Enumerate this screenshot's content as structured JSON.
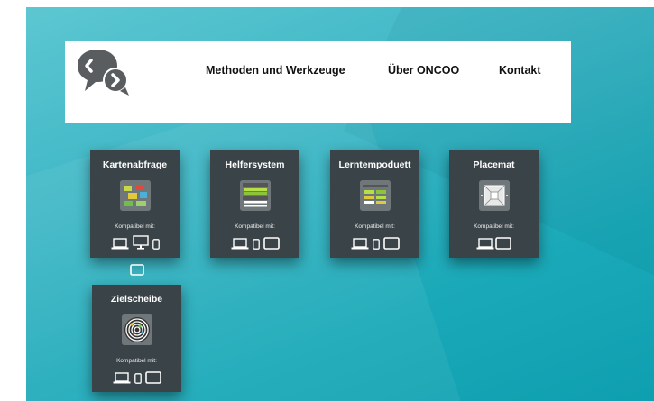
{
  "header": {
    "logo_icon": "speech-bubbles-logo-icon",
    "nav": [
      {
        "label": "Methoden und Werkzeuge"
      },
      {
        "label": "Über ONCOO"
      },
      {
        "label": "Kontakt"
      }
    ]
  },
  "cards": [
    {
      "title": "Kartenabfrage",
      "compat_label": "Kompatibel mit:",
      "image_icon": "kartenabfrage-icon",
      "devices": [
        "laptop",
        "desktop",
        "phone"
      ]
    },
    {
      "title": "Helfersystem",
      "compat_label": "Kompatibel mit:",
      "image_icon": "helfersystem-icon",
      "devices": [
        "laptop",
        "phone",
        "tablet"
      ]
    },
    {
      "title": "Lerntempoduett",
      "compat_label": "Kompatibel mit:",
      "image_icon": "lerntempoduett-icon",
      "devices": [
        "laptop",
        "phone",
        "tablet"
      ]
    },
    {
      "title": "Placemat",
      "compat_label": "Kompatibel mit:",
      "image_icon": "placemat-icon",
      "devices": [
        "laptop",
        "tablet"
      ]
    },
    {
      "title": "Zielscheibe",
      "compat_label": "Kompatibel mit:",
      "image_icon": "zielscheibe-icon",
      "devices": [
        "laptop",
        "phone",
        "tablet"
      ]
    }
  ],
  "colors": {
    "card_bg": "#3a4348",
    "background_teal": "#1aa9b8",
    "header_bg": "#ffffff"
  }
}
